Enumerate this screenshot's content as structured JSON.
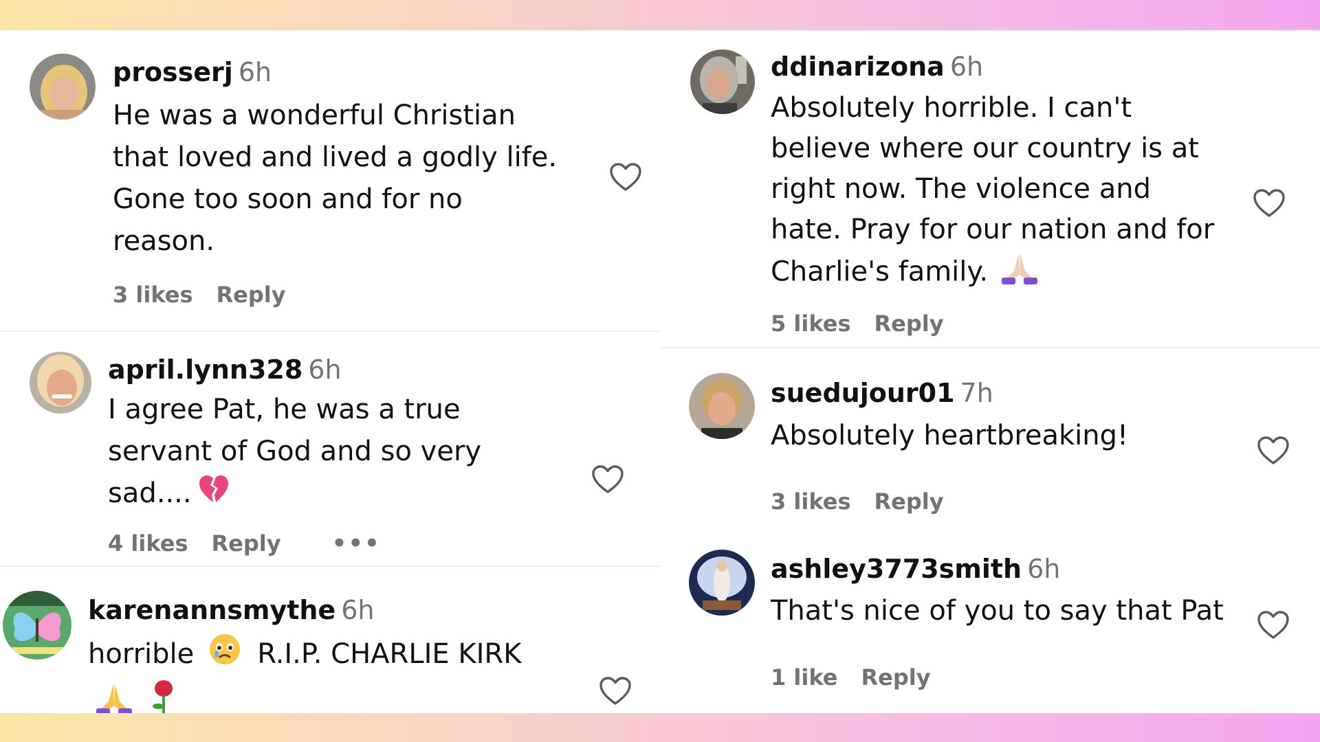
{
  "left_column": [
    {
      "username": "prosserj",
      "time": "6h",
      "lines": [
        "He was a wonderful Christian",
        "that loved and lived a godly life.",
        "Gone too soon and for no",
        "reason."
      ],
      "likes": "3 likes",
      "reply": "Reply"
    },
    {
      "username": "april.lynn328",
      "time": "6h",
      "lines": [
        "I agree Pat, he was a true",
        "servant of God and so very",
        "sad...."
      ],
      "emoji_last_line": "broken-heart",
      "likes": "4 likes",
      "reply": "Reply",
      "more": "•••"
    },
    {
      "username": "karenannsmythe",
      "time": "6h",
      "lines": [
        "horrible",
        "R.I.P. CHARLIE KIRK"
      ],
      "emoji_inline": "crying-face",
      "emoji_next_line": [
        "praying-hands",
        "rose"
      ]
    }
  ],
  "right_column": [
    {
      "username": "ddinarizona",
      "time": "6h",
      "lines": [
        "Absolutely horrible. I can't",
        "believe where our country is at",
        "right now. The violence and",
        "hate. Pray for our nation and for",
        "Charlie's family."
      ],
      "emoji_last_line": "praying-hands",
      "likes": "5 likes",
      "reply": "Reply"
    },
    {
      "username": "suedujour01",
      "time": "7h",
      "lines": [
        "Absolutely heartbreaking!"
      ],
      "likes": "3 likes",
      "reply": "Reply"
    },
    {
      "username": "ashley3773smith",
      "time": "6h",
      "lines": [
        "That's nice of you to say that Pat"
      ],
      "likes": "1 like",
      "reply": "Reply"
    }
  ],
  "colors": {
    "text": "#111111",
    "muted": "#737373",
    "divider": "#efefef",
    "gradient_start": "#fbe8a6",
    "gradient_end": "#f2a6ef"
  },
  "icons": [
    "heart-outline-icon",
    "more-dots-icon"
  ]
}
